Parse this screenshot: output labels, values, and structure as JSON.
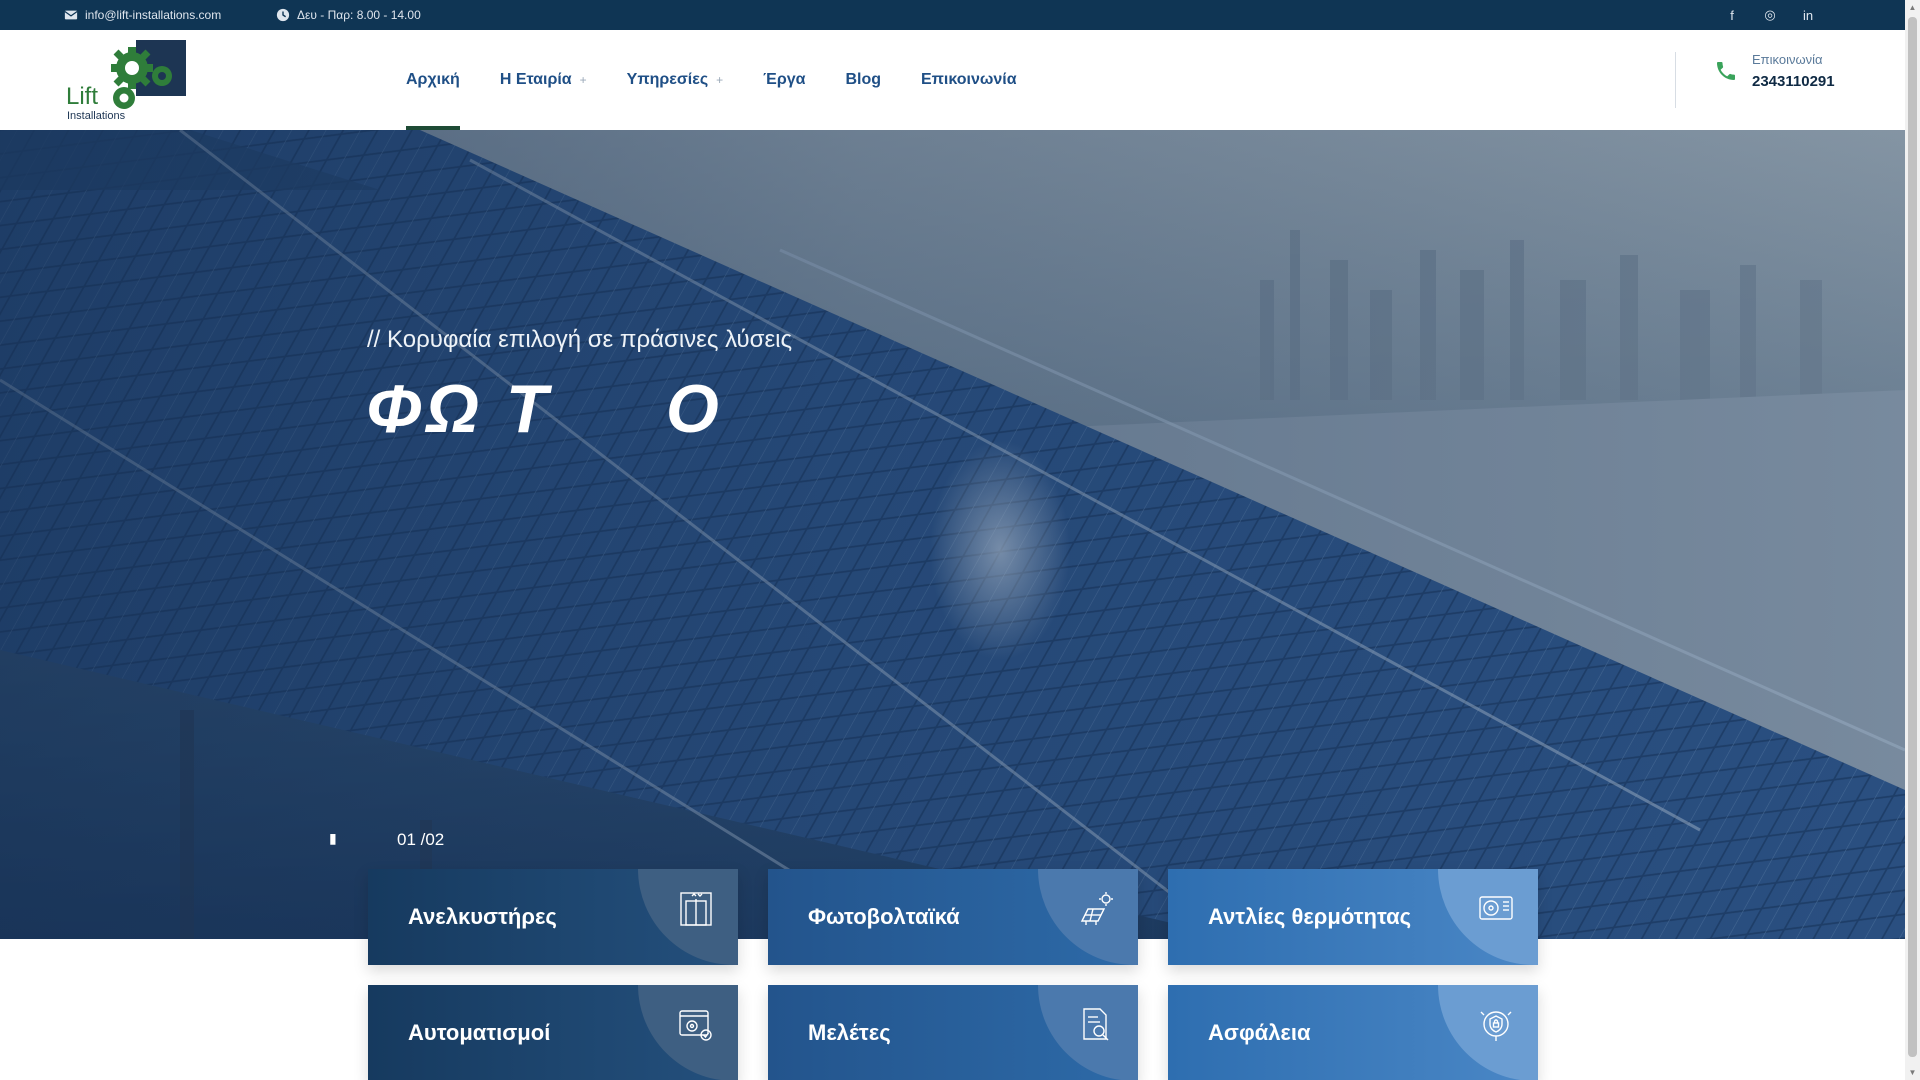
{
  "topbar": {
    "email": "info@lift-installations.com",
    "hours": "Δευ - Παρ: 8.00 - 14.00",
    "socials": [
      "f",
      "◎",
      "in"
    ]
  },
  "header": {
    "logo_main": "Lift",
    "logo_sub": "Installations",
    "nav": [
      {
        "label": "Αρχική",
        "active": true
      },
      {
        "label": "Η Εταιρία",
        "dropdown": "+"
      },
      {
        "label": "Υπηρεσίες",
        "dropdown": "+"
      },
      {
        "label": "Έργα"
      },
      {
        "label": "Blog"
      },
      {
        "label": "Επικοινωνία"
      }
    ],
    "contact_label": "Επικοινωνία",
    "contact_phone": "2343110291"
  },
  "hero": {
    "subtitle": "// Κορυφαία επιλογή σε πράσινες λύσεις",
    "title": "ΦΩ Τ     Ο",
    "arrow": "▮",
    "counter": "01 /02"
  },
  "services": [
    {
      "label": "Ανελκυστήρες",
      "icon": "elevator-icon"
    },
    {
      "label": "Φωτοβολταϊκά",
      "icon": "solar-panel-icon"
    },
    {
      "label": "Αντλίες θερμότητας",
      "icon": "heat-pump-icon"
    },
    {
      "label": "Αυτοματισμοί",
      "icon": "automation-icon"
    },
    {
      "label": "Μελέτες",
      "icon": "study-document-icon"
    },
    {
      "label": "Ασφάλεια",
      "icon": "security-icon"
    }
  ],
  "colors": {
    "topbar": "#0f3554",
    "nav_text": "#1f4f86",
    "active_underline": "#1e4b35",
    "logo_green": "#2f7d3a",
    "logo_navy": "#1d3553",
    "phone_icon": "#3aa35b"
  }
}
